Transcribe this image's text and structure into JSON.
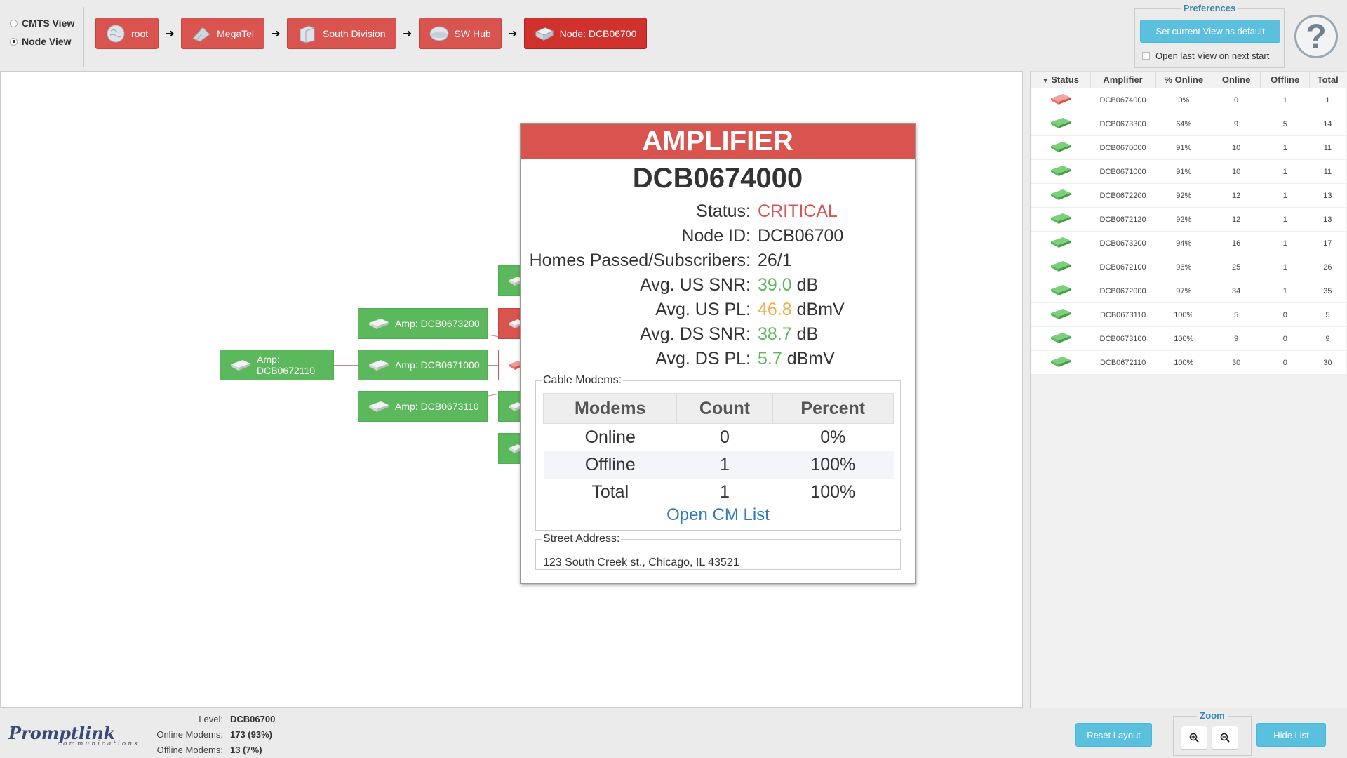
{
  "view_switch": {
    "cmts": "CMTS View",
    "node": "Node View",
    "selected": "node"
  },
  "breadcrumb": [
    {
      "label": "root",
      "icon": "globe-icon"
    },
    {
      "label": "MegaTel",
      "icon": "antenna-icon"
    },
    {
      "label": "South Division",
      "icon": "building-icon"
    },
    {
      "label": "SW Hub",
      "icon": "hub-icon"
    },
    {
      "label": "Node: DCB06700",
      "icon": "node-icon"
    }
  ],
  "preferences": {
    "title": "Preferences",
    "set_default": "Set current View as default",
    "open_last": "Open last View on next start"
  },
  "help": "?",
  "canvas": {
    "amps": [
      {
        "label": "Amp: DCB0673200"
      },
      {
        "label": "Amp: DCB0672110"
      },
      {
        "label": "Amp: DCB0671000"
      },
      {
        "label": "Amp: DCB0673110"
      }
    ]
  },
  "popup": {
    "header": "AMPLIFIER",
    "name": "DCB0674000",
    "status_label": "Status:",
    "status_value": "CRITICAL",
    "node_label": "Node ID:",
    "node_value": "DCB06700",
    "homes_label": "Homes Passed/Subscribers:",
    "homes_value": "26/1",
    "us_snr_label": "Avg. US SNR:",
    "us_snr_value": "39.0",
    "us_snr_unit": "dB",
    "us_pl_label": "Avg. US PL:",
    "us_pl_value": "46.8",
    "us_pl_unit": "dBmV",
    "ds_snr_label": "Avg. DS SNR:",
    "ds_snr_value": "38.7",
    "ds_snr_unit": "dB",
    "ds_pl_label": "Avg. DS PL:",
    "ds_pl_value": "5.7",
    "ds_pl_unit": "dBmV",
    "cable_modems_legend": "Cable Modems:",
    "cm_headers": [
      "Modems",
      "Count",
      "Percent"
    ],
    "cm_rows": [
      [
        "Online",
        "0",
        "0%"
      ],
      [
        "Offline",
        "1",
        "100%"
      ],
      [
        "Total",
        "1",
        "100%"
      ]
    ],
    "open_cm_list": "Open CM List",
    "address_legend": "Street Address:",
    "address": "123 South Creek st., Chicago, IL 43521"
  },
  "list": {
    "headers": [
      "Status",
      "Amplifier",
      "% Online",
      "Online",
      "Offline",
      "Total"
    ],
    "rows": [
      {
        "status": "critical",
        "amp": "DCB0674000",
        "pct": "0%",
        "online": "0",
        "offline": "1",
        "total": "1"
      },
      {
        "status": "ok",
        "amp": "DCB0673300",
        "pct": "64%",
        "online": "9",
        "offline": "5",
        "total": "14"
      },
      {
        "status": "ok",
        "amp": "DCB0670000",
        "pct": "91%",
        "online": "10",
        "offline": "1",
        "total": "11"
      },
      {
        "status": "ok",
        "amp": "DCB0671000",
        "pct": "91%",
        "online": "10",
        "offline": "1",
        "total": "11"
      },
      {
        "status": "ok",
        "amp": "DCB0672200",
        "pct": "92%",
        "online": "12",
        "offline": "1",
        "total": "13"
      },
      {
        "status": "ok",
        "amp": "DCB0672120",
        "pct": "92%",
        "online": "12",
        "offline": "1",
        "total": "13"
      },
      {
        "status": "ok",
        "amp": "DCB0673200",
        "pct": "94%",
        "online": "16",
        "offline": "1",
        "total": "17"
      },
      {
        "status": "ok",
        "amp": "DCB0672100",
        "pct": "96%",
        "online": "25",
        "offline": "1",
        "total": "26"
      },
      {
        "status": "ok",
        "amp": "DCB0672000",
        "pct": "97%",
        "online": "34",
        "offline": "1",
        "total": "35"
      },
      {
        "status": "ok",
        "amp": "DCB0673110",
        "pct": "100%",
        "online": "5",
        "offline": "0",
        "total": "5"
      },
      {
        "status": "ok",
        "amp": "DCB0673100",
        "pct": "100%",
        "online": "9",
        "offline": "0",
        "total": "9"
      },
      {
        "status": "ok",
        "amp": "DCB0672110",
        "pct": "100%",
        "online": "30",
        "offline": "0",
        "total": "30"
      }
    ]
  },
  "footer": {
    "logo": "Promptlink",
    "logo_sub": "communications",
    "level_label": "Level:",
    "level_value": "DCB06700",
    "online_label": "Online Modems:",
    "online_value": "173 (93%)",
    "offline_label": "Offline Modems:",
    "offline_value": "13 (7%)",
    "reset": "Reset Layout",
    "zoom": "Zoom",
    "hide": "Hide List"
  },
  "colors": {
    "critical": "#d9534f",
    "ok": "#5cb85c",
    "warn": "#f0ad4e",
    "accent": "#5bc0de"
  }
}
